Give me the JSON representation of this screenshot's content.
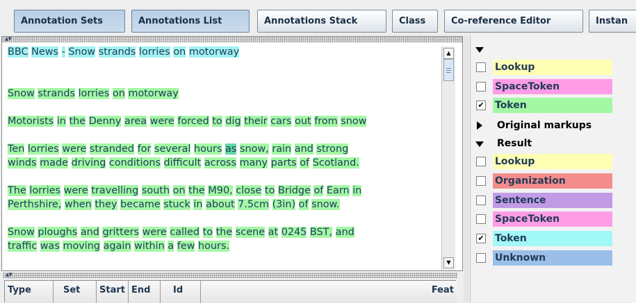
{
  "toolbar": {
    "buttons": [
      {
        "label": "Annotation Sets",
        "pressed": true
      },
      {
        "label": "Annotations List",
        "pressed": true
      },
      {
        "label": "Annotations Stack",
        "pressed": false
      },
      {
        "label": "Class",
        "pressed": false
      },
      {
        "label": "Co-reference Editor",
        "pressed": false
      },
      {
        "label": "Instan",
        "pressed": false
      }
    ]
  },
  "document": {
    "paragraphs": [
      {
        "lines": [
          "BBC News - Snow strands lorries on motorway"
        ]
      },
      {
        "lines": [
          "Snow strands lorries on motorway"
        ]
      },
      {
        "lines": [
          "Motorists in the Denny area were forced to dig their cars out from snow"
        ]
      },
      {
        "lines": [
          "Ten lorries were stranded for several hours as snow, rain and strong",
          "winds made driving conditions difficult across many parts of Scotland."
        ]
      },
      {
        "lines": [
          "The lorries were travelling south on the M90, close to Bridge of Earn in",
          "Perthshire, when they became stuck in about 7.5cm (3in) of snow."
        ]
      },
      {
        "lines": [
          "Snow ploughs and gritters were called to the scene at 0245 BST, and",
          "traffic was moving again within a few hours."
        ]
      }
    ]
  },
  "table": {
    "columns": [
      "Type",
      "Set",
      "Start",
      "End",
      "Id",
      "Feat"
    ]
  },
  "sidebar": {
    "default_set": [
      {
        "label": "Lookup",
        "checked": false,
        "color": "#ffffb4"
      },
      {
        "label": "SpaceToken",
        "checked": false,
        "color": "#ff9ce6"
      },
      {
        "label": "Token",
        "checked": true,
        "color": "#a4f7a4"
      }
    ],
    "original_markups": {
      "label": "Original markups",
      "expanded": false
    },
    "result": {
      "label": "Result",
      "expanded": true,
      "items": [
        {
          "label": "Lookup",
          "checked": false,
          "color": "#ffffb4"
        },
        {
          "label": "Organization",
          "checked": false,
          "color": "#f58c8c"
        },
        {
          "label": "Sentence",
          "checked": false,
          "color": "#c19be6"
        },
        {
          "label": "SpaceToken",
          "checked": false,
          "color": "#ff9ce6"
        },
        {
          "label": "Token",
          "checked": true,
          "color": "#a2f7f7"
        },
        {
          "label": "Unknown",
          "checked": false,
          "color": "#9bbfe9"
        }
      ]
    },
    "check_mark": "✔"
  }
}
